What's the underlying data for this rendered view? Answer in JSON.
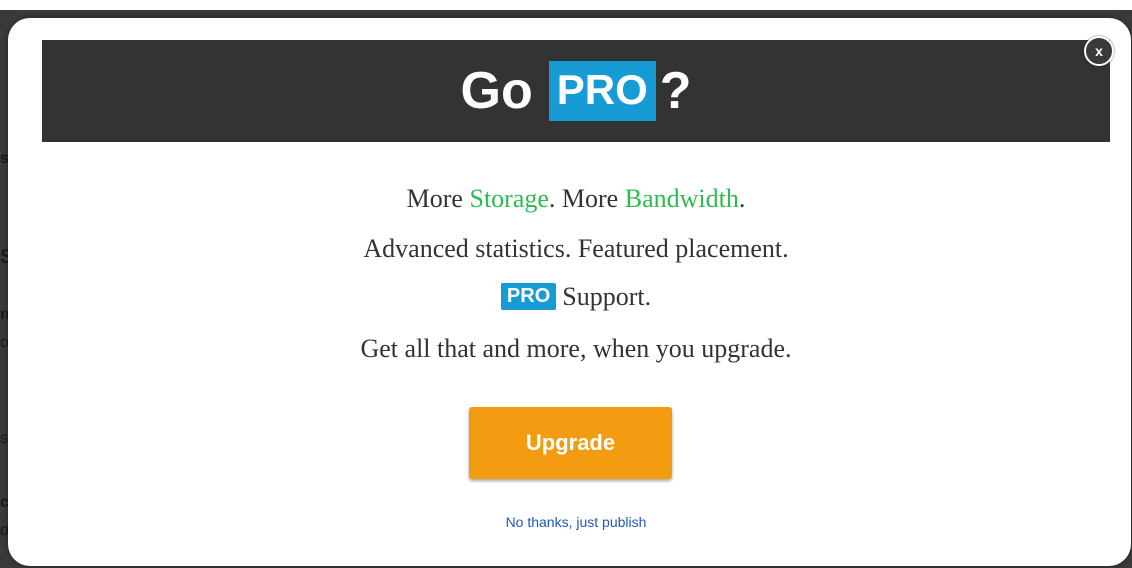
{
  "background": {
    "letters": [
      "s",
      "S",
      "n",
      "o",
      "s",
      "c",
      "d"
    ]
  },
  "modal": {
    "title_prefix": "Go",
    "title_badge": "PRO",
    "title_suffix": "?",
    "close_label": "x",
    "line1": {
      "part1": "More ",
      "highlight1": "Storage",
      "part2": ". More ",
      "highlight2": "Bandwidth",
      "part3": "."
    },
    "line2": "Advanced statistics. Featured placement.",
    "line3": {
      "badge": "PRO",
      "text": "Support."
    },
    "line4": "Get all that and more, when you upgrade.",
    "upgrade_label": "Upgrade",
    "no_thanks_label": "No thanks, just publish"
  },
  "colors": {
    "header_bg": "#333333",
    "pro_blue": "#169bd5",
    "highlight_green": "#2fbb4f",
    "upgrade_orange": "#f39c12",
    "link_blue": "#2255bb"
  }
}
